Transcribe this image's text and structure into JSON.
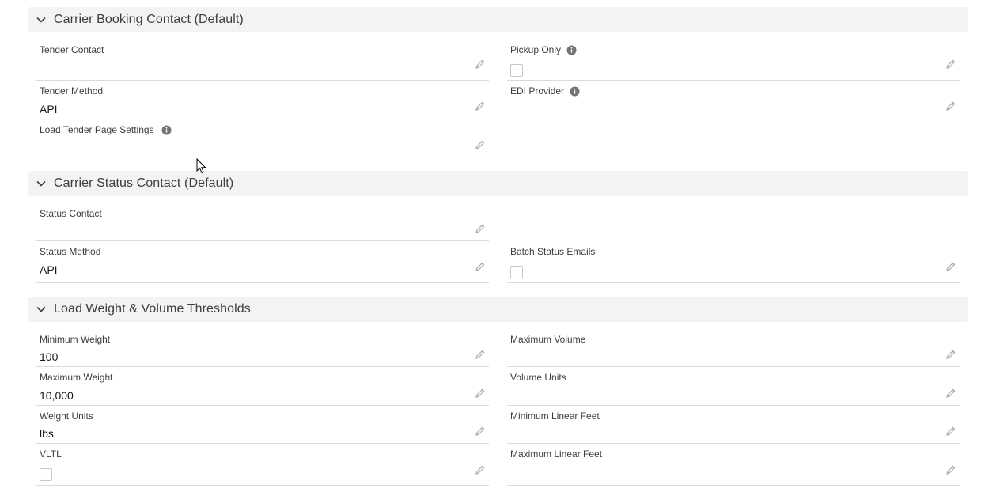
{
  "sections": {
    "booking": {
      "title": "Carrier Booking Contact (Default)",
      "tender_contact": {
        "label": "Tender Contact",
        "value": ""
      },
      "pickup_only": {
        "label": "Pickup Only"
      },
      "tender_method": {
        "label": "Tender Method",
        "value": "API"
      },
      "edi_provider": {
        "label": "EDI Provider",
        "value": ""
      },
      "load_tender_page_settings": {
        "label": "Load Tender Page Settings",
        "value": ""
      }
    },
    "status": {
      "title": "Carrier Status Contact (Default)",
      "status_contact": {
        "label": "Status Contact",
        "value": ""
      },
      "status_method": {
        "label": "Status Method",
        "value": "API"
      },
      "batch_status_emails": {
        "label": "Batch Status Emails"
      }
    },
    "thresholds": {
      "title": "Load Weight & Volume Thresholds",
      "minimum_weight": {
        "label": "Minimum Weight",
        "value": "100"
      },
      "maximum_volume": {
        "label": "Maximum Volume",
        "value": ""
      },
      "maximum_weight": {
        "label": "Maximum Weight",
        "value": "10,000"
      },
      "volume_units": {
        "label": "Volume Units",
        "value": ""
      },
      "weight_units": {
        "label": "Weight Units",
        "value": "lbs"
      },
      "minimum_linear_feet": {
        "label": "Minimum Linear Feet",
        "value": ""
      },
      "vltl": {
        "label": "VLTL"
      },
      "maximum_linear_feet": {
        "label": "Maximum Linear Feet",
        "value": ""
      }
    }
  },
  "icons": {
    "chevron": "chevron-down-icon",
    "edit": "pencil-icon",
    "info": "info-icon"
  },
  "colors": {
    "section_bg": "#f3f3f3",
    "divider": "#dddbda",
    "label": "#3e3e3c",
    "icon": "#b0adab"
  }
}
